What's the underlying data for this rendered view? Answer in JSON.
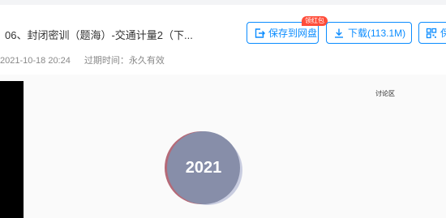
{
  "file": {
    "title": "06、封闭密训（题海）-交通计量2（下...",
    "share_time": "2021-10-18 20:24",
    "expiry": "过期时间：永久有效"
  },
  "toolbar": {
    "save_label": "保存到网盘",
    "badge_label": "领红包",
    "download_label": "下载(113.1M)",
    "qr_label": "保"
  },
  "viewer": {
    "discussion_label": "讨论区",
    "year_label": "2021"
  },
  "colors": {
    "accent": "#0b8cff",
    "badge": "#ff4d3a",
    "disc": "#878ea9"
  }
}
